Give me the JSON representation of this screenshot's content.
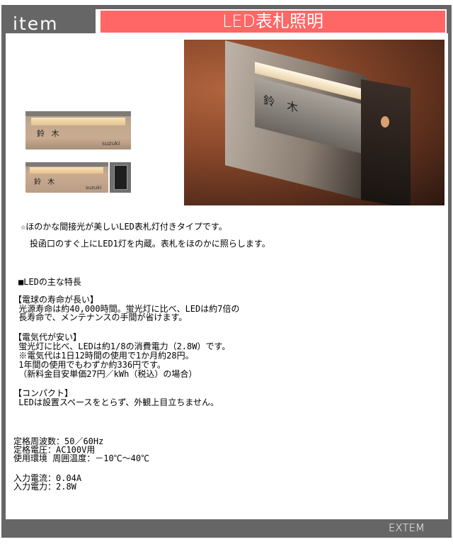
{
  "header": {
    "section_label": "item",
    "title": "LED表札照明"
  },
  "products": [
    {
      "name_kanji": "鈴 木",
      "name_roman": "suzuki",
      "variant": "nameplate-light"
    },
    {
      "name_kanji": "鈴 木",
      "name_roman": "suzuki",
      "variant": "nameplate-light-with-intercom"
    }
  ],
  "photo": {
    "name_kanji": "鈴 木",
    "alt": "LED nameplate light installed on wall with intercom"
  },
  "intro": {
    "line1": "☆ほのかな間接光が美しいLED表札灯付きタイプです。",
    "line2": "投函口のすぐ上にLED1灯を内蔵。表札をほのかに照らします。"
  },
  "features": {
    "heading": "■LEDの主な特長",
    "sections": [
      {
        "title": "【電球の寿命が長い】",
        "lines": [
          " 光源寿命は約40,000時間。蛍光灯に比べ、LEDは約7倍の",
          " 長寿命で、メンテナンスの手間が省けます。"
        ]
      },
      {
        "title": "【電気代が安い】",
        "lines": [
          " 蛍光灯に比べ、LEDは約1/8の消費電力（2.8W）です。",
          " ※電気代は1日12時間の使用で1か月約28円。",
          " 1年間の使用でもわずか約336円です。",
          " （新料金目安単価27円／kWh（税込）の場合）"
        ]
      },
      {
        "title": "【コンパクト】",
        "lines": [
          " LEDは設置スペースをとらず、外観上目立ちません。"
        ]
      }
    ]
  },
  "specs": {
    "group1": [
      "定格周波数：50／60Hz",
      "定格電圧：AC100V用",
      "使用環境 周囲温度：－10℃～40℃"
    ],
    "group2": [
      "入力電流：0.04A",
      "入力電力：2.8W"
    ]
  },
  "footer": {
    "brand": "EXTEM"
  },
  "colors": {
    "frame": "#666666",
    "title_bg": "#ff6666",
    "text": "#000000"
  }
}
